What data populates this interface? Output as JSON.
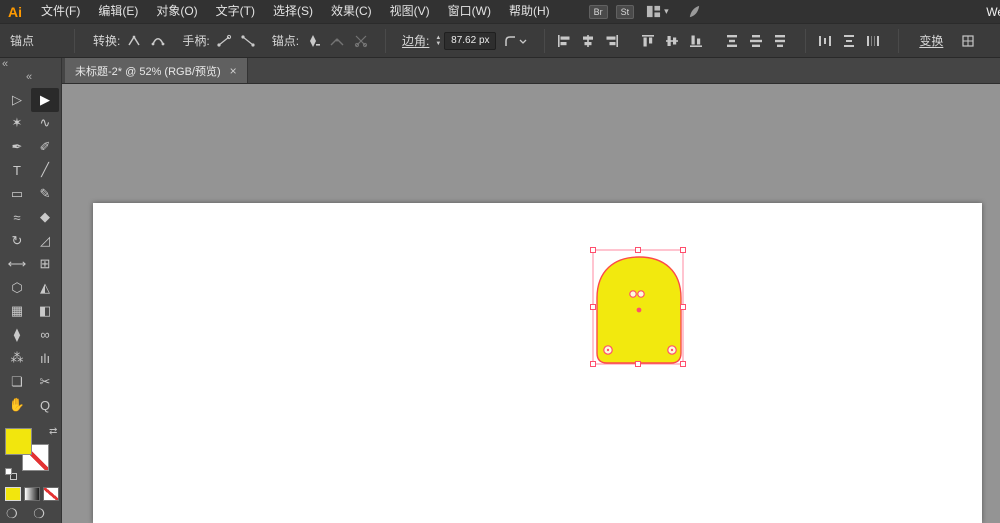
{
  "app": {
    "logo_label": "Ai",
    "workspace_label_partial": "We"
  },
  "menubar": {
    "items": [
      "文件(F)",
      "编辑(E)",
      "对象(O)",
      "文字(T)",
      "选择(S)",
      "效果(C)",
      "视图(V)",
      "窗口(W)",
      "帮助(H)"
    ],
    "bridge_label": "Br",
    "stock_label": "St"
  },
  "control_bar": {
    "context_label": "锚点",
    "convert_label": "转换:",
    "handles_label": "手柄:",
    "anchor_label": "锚点:",
    "corner_label": "边角:",
    "corner_value": "87.62 px",
    "transform_label": "变换"
  },
  "tabbar": {
    "title": "未标题-2* @ 52% (RGB/预览)",
    "close_glyph": "×"
  },
  "icons": {
    "collapse_glyph": "«",
    "swap_glyph": "⇄",
    "spinner_up": "▲",
    "spinner_down": "▼",
    "chevron_down": "▾",
    "screen_mode_glyphs": "❍ ❍"
  },
  "tools": [
    {
      "name": "direct-selection",
      "glyph": "▷"
    },
    {
      "name": "selection",
      "glyph": "▶"
    },
    {
      "name": "magic-wand",
      "glyph": "✶"
    },
    {
      "name": "lasso",
      "glyph": "∿"
    },
    {
      "name": "pen",
      "glyph": "✒"
    },
    {
      "name": "paintbrush",
      "glyph": "✐"
    },
    {
      "name": "type",
      "glyph": "T"
    },
    {
      "name": "line-segment",
      "glyph": "╱"
    },
    {
      "name": "rectangle",
      "glyph": "▭"
    },
    {
      "name": "pencil",
      "glyph": "✎"
    },
    {
      "name": "shaper",
      "glyph": "≈"
    },
    {
      "name": "eraser",
      "glyph": "◆"
    },
    {
      "name": "rotate",
      "glyph": "↻"
    },
    {
      "name": "scale",
      "glyph": "◿"
    },
    {
      "name": "width",
      "glyph": "⟷"
    },
    {
      "name": "free-transform",
      "glyph": "⊞"
    },
    {
      "name": "shape-builder",
      "glyph": "⬡"
    },
    {
      "name": "perspective-grid",
      "glyph": "◭"
    },
    {
      "name": "mesh",
      "glyph": "▦"
    },
    {
      "name": "gradient",
      "glyph": "◧"
    },
    {
      "name": "eyedropper",
      "glyph": "⧫"
    },
    {
      "name": "blend",
      "glyph": "∞"
    },
    {
      "name": "symbol-sprayer",
      "glyph": "⁂"
    },
    {
      "name": "column-graph",
      "glyph": "ılı"
    },
    {
      "name": "artboard",
      "glyph": "❏"
    },
    {
      "name": "slice",
      "glyph": "✂"
    },
    {
      "name": "hand",
      "glyph": "✋"
    },
    {
      "name": "zoom",
      "glyph": "Q"
    }
  ],
  "swatch_panel": {
    "fill_color": "#f2e60d",
    "stroke_style": "none"
  },
  "canvas": {
    "pasteboard_color": "#949494",
    "artboard_color": "#ffffff",
    "shape_fill": "#f2e90e",
    "shape_stroke": "#fb4a4a",
    "selection_color": "#ff4f6d"
  }
}
